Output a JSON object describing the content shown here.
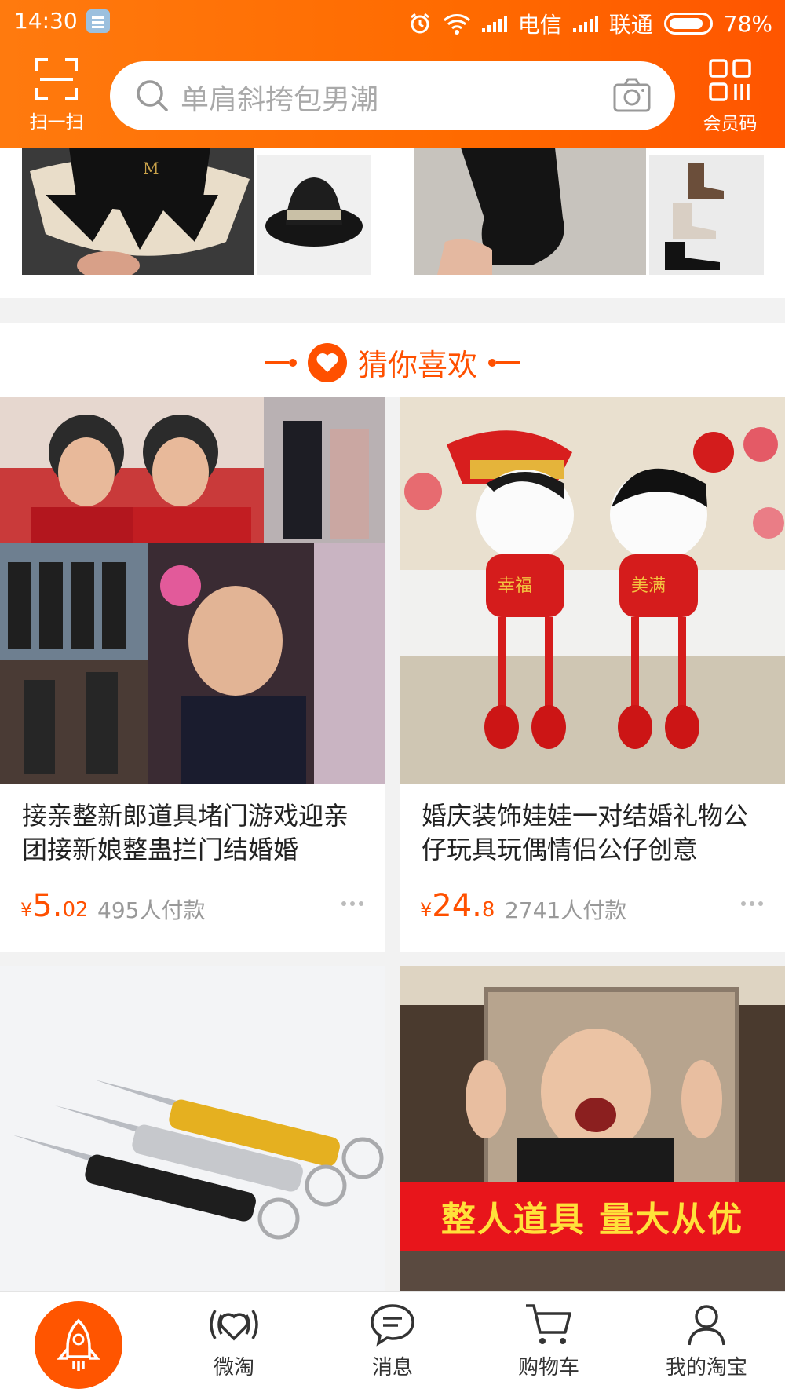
{
  "status_bar": {
    "time": "14:30",
    "carrier1": "电信",
    "carrier2": "联通",
    "battery": "78%"
  },
  "header": {
    "scan_label": "扫一扫",
    "search_placeholder": "单肩斜挎包男潮",
    "member_label": "会员码"
  },
  "guess": {
    "title": "猜你喜欢"
  },
  "products": [
    {
      "title": "接亲整新郎道具堵门游戏迎亲团接新娘整蛊拦门结婚婚",
      "currency": "¥",
      "price_int": "5.",
      "price_dec": "02",
      "sold": "495人付款"
    },
    {
      "title": "婚庆装饰娃娃一对结婚礼物公仔玩具玩偶情侣公仔创意",
      "currency": "¥",
      "price_int": "24.",
      "price_dec": "8",
      "sold": "2741人付款"
    }
  ],
  "product4_banner": "整人道具 量大从优",
  "product2_badges": [
    "幸福",
    "美满"
  ],
  "hat_logo": "M",
  "tabs": {
    "weitao": "微淘",
    "messages": "消息",
    "cart": "购物车",
    "mine": "我的淘宝"
  },
  "colors": {
    "brand": "#ff5000",
    "header": "#ff6a00"
  }
}
